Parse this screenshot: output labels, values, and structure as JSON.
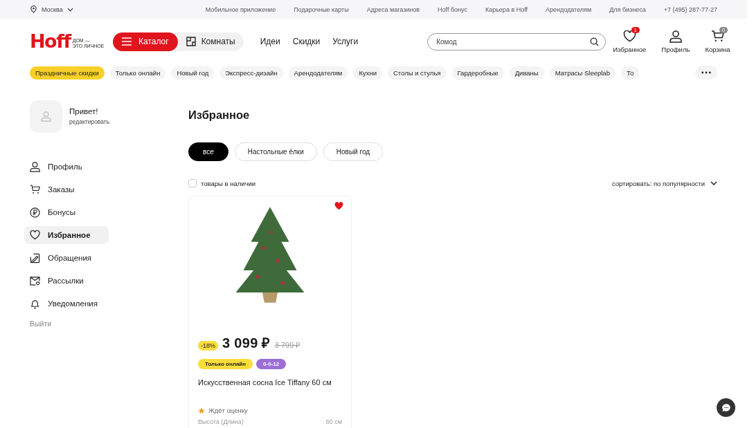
{
  "topbar": {
    "city": "Москва",
    "links": [
      "Мобильное приложение",
      "Подарочные карты",
      "Адреса магазинов",
      "Hoff бонус",
      "Карьера в Hoff",
      "Арендодателям",
      "Для бизнеса"
    ],
    "phone": "+7 (495) 287-77-27"
  },
  "header": {
    "logo": "Hoff",
    "slogan_1": "ДОМ —",
    "slogan_2": "ЭТО ЛИЧНОЕ",
    "catalog": "Каталог",
    "rooms": "Комнаты",
    "nav": [
      "Идеи",
      "Скидки",
      "Услуги"
    ],
    "search": {
      "placeholder": "Комод"
    },
    "actions": [
      {
        "kind": "favorites",
        "label": "Избранное",
        "badge": "1"
      },
      {
        "kind": "profile",
        "label": "Профиль"
      },
      {
        "kind": "cart",
        "label": "Корзина",
        "badge": "0"
      }
    ]
  },
  "categories": [
    {
      "label": "Праздничные скидки",
      "selected": true
    },
    {
      "label": "Только онлайн",
      "selected": false
    },
    {
      "label": "Новый год",
      "selected": false
    },
    {
      "label": "Экспресс-дизайн",
      "selected": false
    },
    {
      "label": "Арендодателям",
      "selected": false
    },
    {
      "label": "Кухни",
      "selected": false
    },
    {
      "label": "Столы и стулья",
      "selected": false
    },
    {
      "label": "Гардеробные",
      "selected": false
    },
    {
      "label": "Диваны",
      "selected": false
    },
    {
      "label": "Матрасы Sleeplab",
      "selected": false
    },
    {
      "label": "То",
      "selected": false
    }
  ],
  "sidebar": {
    "greeting": "Привет!",
    "edit": "редактировать",
    "items": [
      {
        "kind": "profile",
        "label": "Профиль",
        "selected": false
      },
      {
        "kind": "orders",
        "label": "Заказы",
        "selected": false
      },
      {
        "kind": "bonus",
        "label": "Бонусы",
        "selected": false
      },
      {
        "kind": "favorites",
        "label": "Избранное",
        "selected": true
      },
      {
        "kind": "requests",
        "label": "Обращения",
        "selected": false
      },
      {
        "kind": "mail",
        "label": "Рассылки",
        "selected": false
      },
      {
        "kind": "notify",
        "label": "Уведомления",
        "selected": false
      }
    ],
    "logout": "Выйти"
  },
  "page": {
    "title": "Избранное",
    "filters": [
      {
        "label": "все",
        "selected": true
      },
      {
        "label": "Настольные ёлки",
        "selected": false
      },
      {
        "label": "Новый год",
        "selected": false
      }
    ],
    "in_stock": {
      "label": "товары в наличии",
      "checked": false
    },
    "sort": "сортировать: по популярности",
    "products": [
      {
        "favorite": true,
        "discount": "-18%",
        "price": "3 099 ₽",
        "old_price": "3 799 ₽",
        "tags": [
          {
            "label": "Только онлайн",
            "color": "#f9dd3c"
          },
          {
            "label": "0-0-12",
            "color": "#9b6fd4"
          }
        ],
        "name": "Искусственная сосна Ice Tiffany 60 см",
        "rating": "Ждёт оценку",
        "spec_name": "Высота (Длина)",
        "spec_value": "60 см"
      }
    ]
  }
}
